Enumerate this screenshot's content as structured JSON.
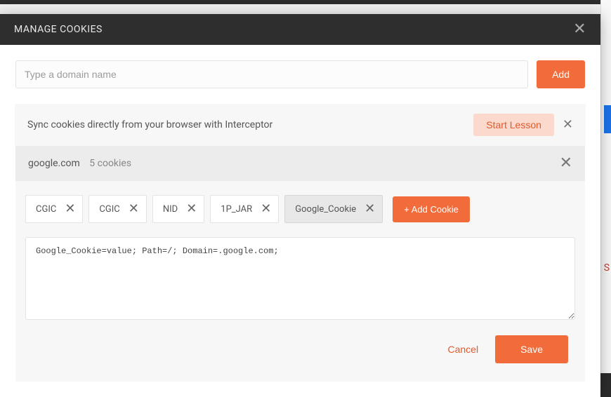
{
  "header": {
    "title": "MANAGE COOKIES"
  },
  "domain_input": {
    "placeholder": "Type a domain name",
    "add_label": "Add"
  },
  "lesson_banner": {
    "text": "Sync cookies directly from your browser with Interceptor",
    "button": "Start Lesson"
  },
  "domain_section": {
    "name": "google.com",
    "count": "5 cookies"
  },
  "cookies": [
    {
      "name": "CGIC",
      "selected": false
    },
    {
      "name": "CGIC",
      "selected": false
    },
    {
      "name": "NID",
      "selected": false
    },
    {
      "name": "1P_JAR",
      "selected": false
    },
    {
      "name": "Google_Cookie",
      "selected": true
    }
  ],
  "add_cookie_label": "+ Add Cookie",
  "cookie_value": "Google_Cookie=value; Path=/; Domain=.google.com;",
  "actions": {
    "cancel": "Cancel",
    "save": "Save"
  }
}
